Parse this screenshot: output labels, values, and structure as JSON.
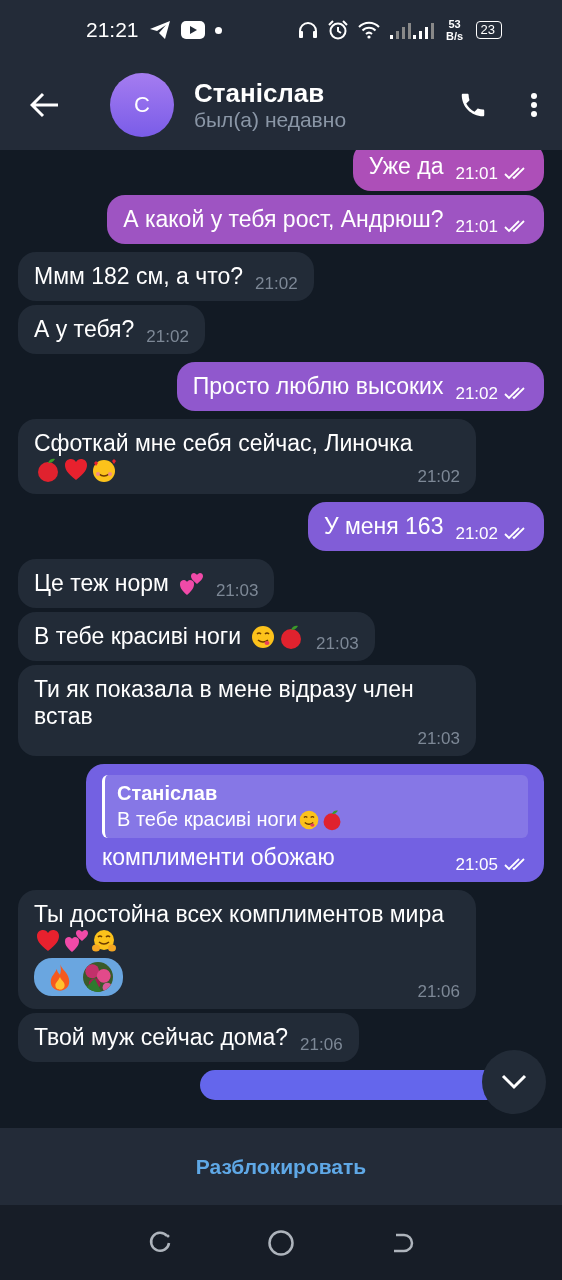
{
  "status_bar": {
    "time": "21:21",
    "net_speed": "53 B/s",
    "battery": "23"
  },
  "header": {
    "avatar_letter": "С",
    "name": "Станіслав",
    "status": "был(а) недавно"
  },
  "messages": [
    {
      "kind": "outgoing",
      "text": "Уже да",
      "time": "21:01",
      "read": true
    },
    {
      "kind": "outgoing",
      "text": "А какой у тебя рост, Андрюш?",
      "time": "21:01",
      "read": true
    },
    {
      "kind": "incoming",
      "text": "Ммм 182 см, а что?",
      "time": "21:02"
    },
    {
      "kind": "incoming",
      "text": "А у тебя?",
      "time": "21:02"
    },
    {
      "kind": "outgoing",
      "text": "Просто люблю высоких",
      "time": "21:02",
      "read": true
    },
    {
      "kind": "incoming",
      "text": "Сфоткай мне себя сейчас, Линочка",
      "emojis": [
        {
          "kind": "apple"
        },
        {
          "kind": "heart"
        },
        {
          "kind": "smile-hearts"
        }
      ],
      "time": "21:02"
    },
    {
      "kind": "outgoing",
      "text": "У меня 163",
      "time": "21:02",
      "read": true
    },
    {
      "kind": "incoming",
      "text": "Це теж норм",
      "emojis": [
        {
          "kind": "two-hearts"
        }
      ],
      "time": "21:03"
    },
    {
      "kind": "incoming",
      "text": "В тебе красиві ноги",
      "emojis": [
        {
          "kind": "yum"
        },
        {
          "kind": "apple"
        }
      ],
      "time": "21:03"
    },
    {
      "kind": "incoming",
      "text": "Ти як показала в мене відразу член встав",
      "time": "21:03"
    },
    {
      "kind": "outgoing",
      "reply": {
        "name": "Станіслав",
        "text": "В тебе красиві ноги",
        "emojis": [
          {
            "kind": "yum"
          },
          {
            "kind": "apple"
          }
        ]
      },
      "text": "комплименти обожаю",
      "time": "21:05",
      "read": true
    },
    {
      "kind": "incoming",
      "text": "Ты достойна всех комплиментов мира",
      "emojis": [
        {
          "kind": "heart"
        },
        {
          "kind": "two-hearts"
        },
        {
          "kind": "hug"
        }
      ],
      "reactions": [
        {
          "kind": "fire"
        },
        {
          "kind": "picture"
        }
      ],
      "time": "21:06"
    },
    {
      "kind": "incoming",
      "text": "Твой муж сейчас дома?",
      "time": "21:06"
    },
    {
      "kind": "partial"
    }
  ],
  "footer": {
    "button": "Разблокировать"
  }
}
